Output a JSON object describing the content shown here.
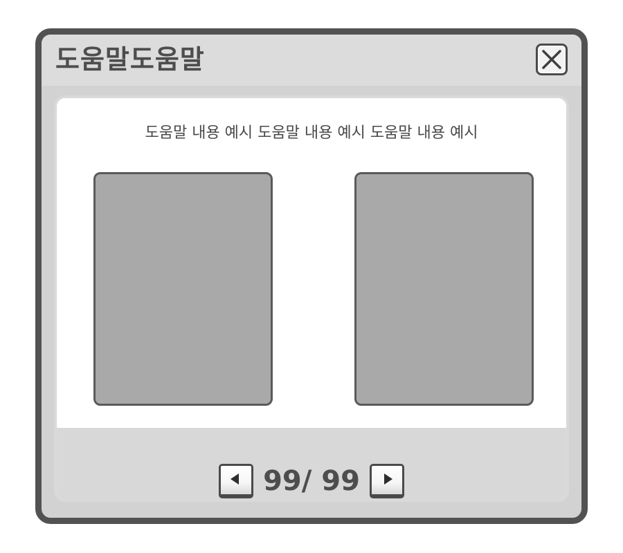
{
  "dialog": {
    "title": "도움말도움말",
    "close_icon": "close-x-icon"
  },
  "content": {
    "description": "도움말 내용 예시 도움말 내용 예시 도움말 내용 예시"
  },
  "pager": {
    "text": "99/ 99",
    "prev_icon": "triangle-left-icon",
    "next_icon": "triangle-right-icon"
  },
  "colors": {
    "frame": "#525252",
    "title_bg": "#dcdcdc",
    "panel_bg": "#ffffff",
    "image_placeholder": "#a9a9a9",
    "text": "#4d4d4d"
  }
}
